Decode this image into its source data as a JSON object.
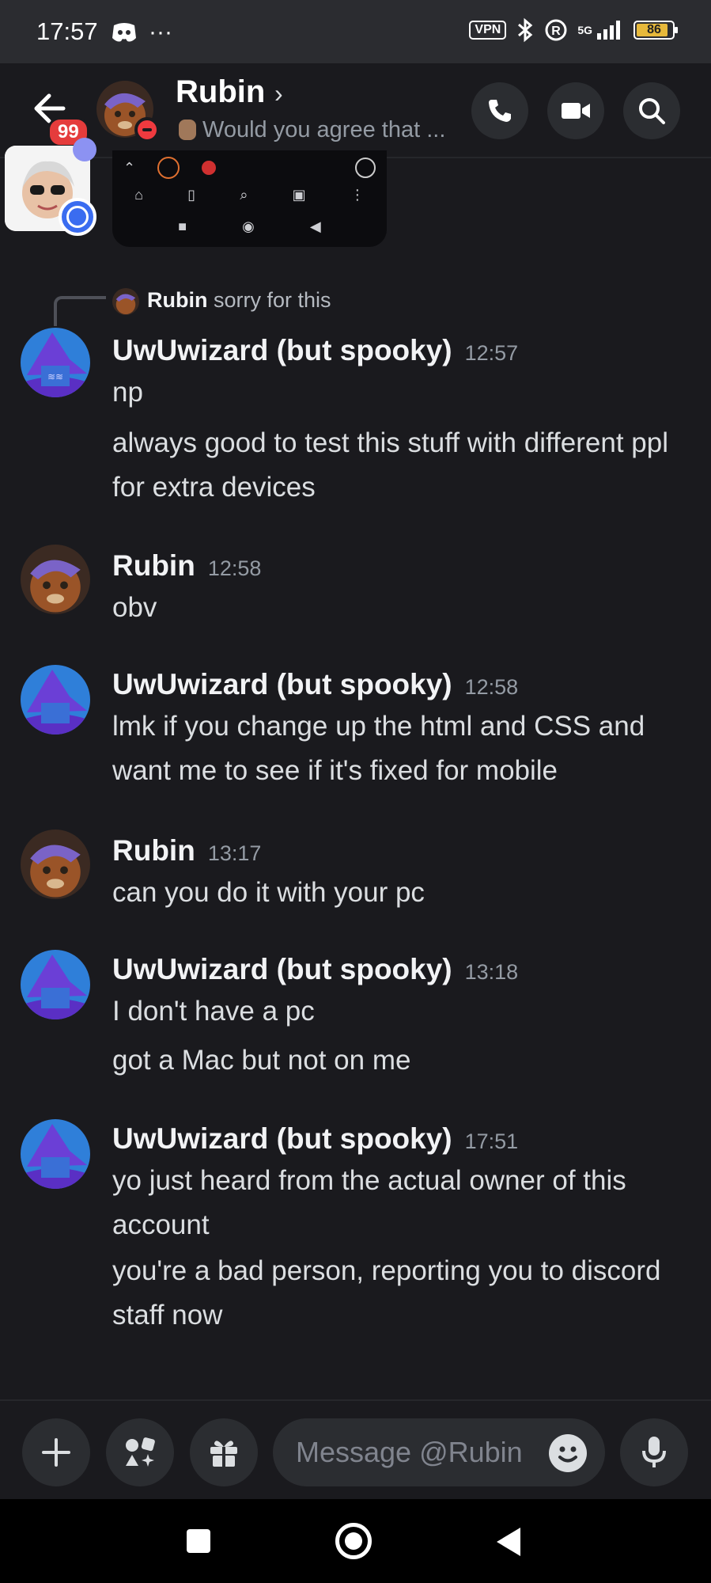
{
  "status_bar": {
    "time": "17:57",
    "more": "···",
    "vpn": "VPN",
    "network": "5G",
    "battery": "86"
  },
  "header": {
    "unread_badge": "99",
    "name": "Rubin",
    "chevron": "›",
    "status_text": "Would you agree that ..."
  },
  "reply": {
    "author": "Rubin",
    "text": "sorry for this"
  },
  "messages": [
    {
      "author": "UwUwizard (but spooky)",
      "time": "12:57",
      "lines": [
        "np",
        "always good to test this stuff with different ppl for extra devices"
      ]
    },
    {
      "author": "Rubin",
      "time": "12:58",
      "lines": [
        "obv"
      ]
    },
    {
      "author": "UwUwizard (but spooky)",
      "time": "12:58",
      "lines": [
        "lmk if you change up the html and CSS and want me to see if it's fixed for mobile"
      ]
    },
    {
      "author": "Rubin",
      "time": "13:17",
      "lines": [
        "can you do it with your pc"
      ]
    },
    {
      "author": "UwUwizard (but spooky)",
      "time": "13:18",
      "lines": [
        "I don't have a pc",
        "got a Mac but not on me"
      ]
    },
    {
      "author": "UwUwizard (but spooky)",
      "time": "17:51",
      "lines": [
        "yo just heard from the actual owner of this account",
        "you're a bad person, reporting you to discord staff now"
      ]
    }
  ],
  "composer": {
    "placeholder": "Message @Rubin"
  },
  "colors": {
    "background": "#1a1a1e",
    "surface": "#2b2d31",
    "dnd_red": "#ef3a3f",
    "badge_red": "#e53c3c",
    "wizard_purple": "#6b3fd6"
  }
}
